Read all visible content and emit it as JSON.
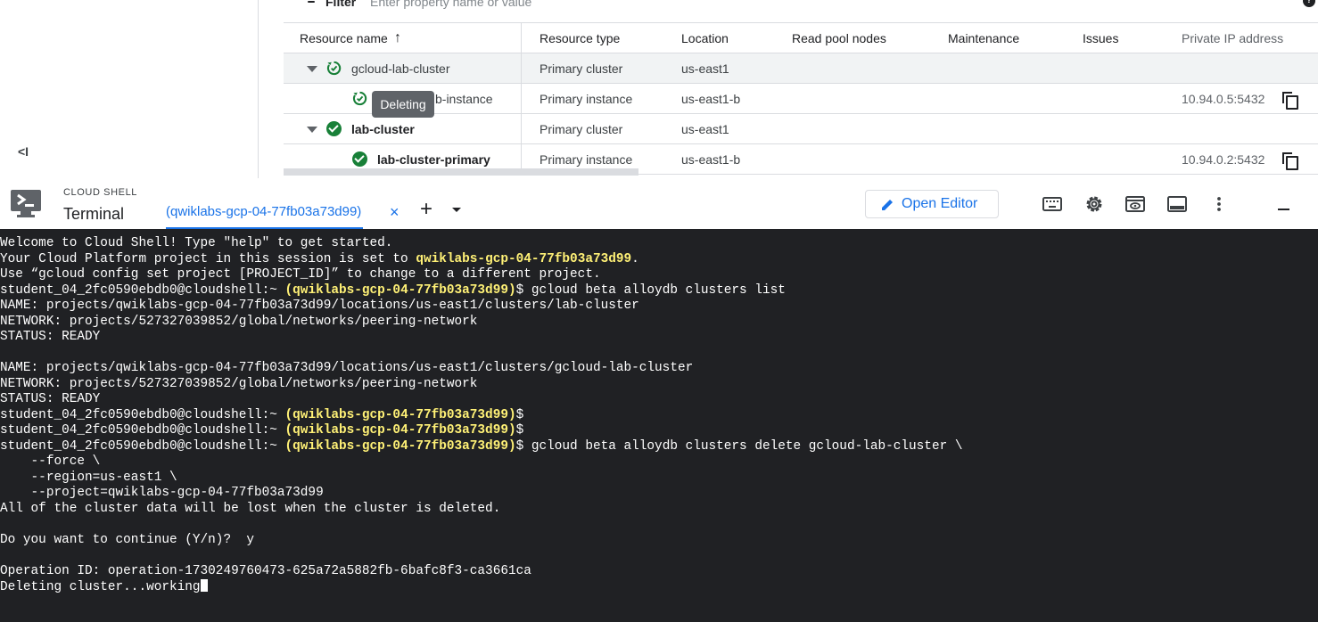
{
  "console": {
    "collapse_icon": "collapse-left-icon",
    "collapse_label": "<I",
    "filter": {
      "label": "Filter",
      "placeholder": "Enter property name or value"
    },
    "table": {
      "headers": [
        "Resource name",
        "Resource type",
        "Location",
        "Read pool nodes",
        "Maintenance",
        "Issues",
        "Private IP address"
      ],
      "sort_icon": "arrow-upward-icon",
      "rows": [
        {
          "name": "gcloud-lab-cluster",
          "type": "Primary cluster",
          "location": "us-east1",
          "ip": "",
          "status": "in-progress",
          "expanded": true,
          "level": 0
        },
        {
          "name": "b-instance",
          "type": "Primary instance",
          "location": "us-east1-b",
          "ip": "10.94.0.5:5432",
          "status": "in-progress",
          "level": 1
        },
        {
          "name": "lab-cluster",
          "type": "Primary cluster",
          "location": "us-east1",
          "ip": "",
          "status": "ready",
          "expanded": true,
          "level": 0
        },
        {
          "name": "lab-cluster-primary",
          "type": "Primary instance",
          "location": "us-east1-b",
          "ip": "10.94.0.2:5432",
          "status": "ready",
          "level": 1
        }
      ]
    },
    "tooltip": "Deleting"
  },
  "shell": {
    "section_label": "CLOUD SHELL",
    "title": "Terminal",
    "tab_label": "(qwiklabs-gcp-04-77fb03a73d99)",
    "tab_close": "×",
    "add_tab": "+",
    "open_editor": "Open Editor",
    "toolbar_icons": [
      "keyboard-icon",
      "settings-icon",
      "web-preview-icon",
      "layout-icon",
      "more-vert-icon",
      "minimize-icon"
    ]
  },
  "terminal": {
    "lines": [
      [
        {
          "t": "Welcome to Cloud Shell! Type \"help\" to get started.",
          "c": "p"
        }
      ],
      [
        {
          "t": "Your Cloud Platform project in this session is set to ",
          "c": "p"
        },
        {
          "t": "qwiklabs-gcp-04-77fb03a73d99",
          "c": "y"
        },
        {
          "t": ".",
          "c": "p"
        }
      ],
      [
        {
          "t": "Use “gcloud config set project [PROJECT_ID]” to change to a different project.",
          "c": "p"
        }
      ],
      [
        {
          "t": "student_04_2fc0590ebdb0@cloudshell:~ ",
          "c": "p"
        },
        {
          "t": "(qwiklabs-gcp-04-77fb03a73d99)",
          "c": "y"
        },
        {
          "t": "$ gcloud beta alloydb clusters list",
          "c": "p"
        }
      ],
      [
        {
          "t": "NAME: projects/qwiklabs-gcp-04-77fb03a73d99/locations/us-east1/clusters/lab-cluster",
          "c": "p"
        }
      ],
      [
        {
          "t": "NETWORK: projects/527327039852/global/networks/peering-network",
          "c": "p"
        }
      ],
      [
        {
          "t": "STATUS: READY",
          "c": "p"
        }
      ],
      [
        {
          "t": "",
          "c": "p"
        }
      ],
      [
        {
          "t": "NAME: projects/qwiklabs-gcp-04-77fb03a73d99/locations/us-east1/clusters/gcloud-lab-cluster",
          "c": "p"
        }
      ],
      [
        {
          "t": "NETWORK: projects/527327039852/global/networks/peering-network",
          "c": "p"
        }
      ],
      [
        {
          "t": "STATUS: READY",
          "c": "p"
        }
      ],
      [
        {
          "t": "student_04_2fc0590ebdb0@cloudshell:~ ",
          "c": "p"
        },
        {
          "t": "(qwiklabs-gcp-04-77fb03a73d99)",
          "c": "y"
        },
        {
          "t": "$",
          "c": "p"
        }
      ],
      [
        {
          "t": "student_04_2fc0590ebdb0@cloudshell:~ ",
          "c": "p"
        },
        {
          "t": "(qwiklabs-gcp-04-77fb03a73d99)",
          "c": "y"
        },
        {
          "t": "$",
          "c": "p"
        }
      ],
      [
        {
          "t": "student_04_2fc0590ebdb0@cloudshell:~ ",
          "c": "p"
        },
        {
          "t": "(qwiklabs-gcp-04-77fb03a73d99)",
          "c": "y"
        },
        {
          "t": "$ gcloud beta alloydb clusters delete gcloud-lab-cluster \\",
          "c": "p"
        }
      ],
      [
        {
          "t": "    --force \\",
          "c": "p"
        }
      ],
      [
        {
          "t": "    --region=us-east1 \\",
          "c": "p"
        }
      ],
      [
        {
          "t": "    --project=qwiklabs-gcp-04-77fb03a73d99",
          "c": "p"
        }
      ],
      [
        {
          "t": "All of the cluster data will be lost when the cluster is deleted.",
          "c": "p"
        }
      ],
      [
        {
          "t": "",
          "c": "p"
        }
      ],
      [
        {
          "t": "Do you want to continue (Y/n)?  y",
          "c": "p"
        }
      ],
      [
        {
          "t": "",
          "c": "p"
        }
      ],
      [
        {
          "t": "Operation ID: operation-1730249760473-625a72a5882fb-6bafc8f3-ca3661ca",
          "c": "p"
        }
      ],
      [
        {
          "t": "Deleting cluster...working",
          "c": "p"
        }
      ]
    ],
    "cursor_icon": "terminal-cursor"
  },
  "colors": {
    "accent": "#1a73e8",
    "ok": "#188038",
    "prompt_project": "#fff176",
    "terminal_bg": "#202124"
  }
}
